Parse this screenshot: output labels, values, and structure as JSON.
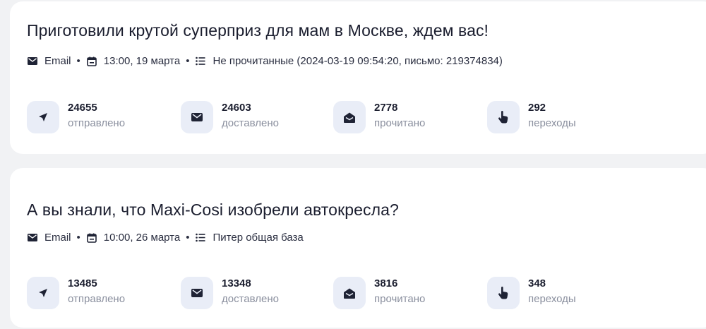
{
  "campaigns": [
    {
      "title": "Приготовили крутой суперприз для мам в Москве, ждем вас!",
      "channel": "Email",
      "datetime": "13:00, 19 марта",
      "segment": "Не прочитанные (2024-03-19 09:54:20, письмо: 219374834)",
      "stats": [
        {
          "value": "24655",
          "label": "отправлено",
          "icon": "send-icon"
        },
        {
          "value": "24603",
          "label": "доставлено",
          "icon": "envelope-icon"
        },
        {
          "value": "2778",
          "label": "прочитано",
          "icon": "envelope-open-icon"
        },
        {
          "value": "292",
          "label": "переходы",
          "icon": "pointer-hand-icon"
        }
      ]
    },
    {
      "title": "А вы знали, что Maxi-Cosi изобрели автокресла?",
      "channel": "Email",
      "datetime": "10:00, 26 марта",
      "segment": "Питер общая база",
      "stats": [
        {
          "value": "13485",
          "label": "отправлено",
          "icon": "send-icon"
        },
        {
          "value": "13348",
          "label": "доставлено",
          "icon": "envelope-icon"
        },
        {
          "value": "3816",
          "label": "прочитано",
          "icon": "envelope-open-icon"
        },
        {
          "value": "348",
          "label": "переходы",
          "icon": "pointer-hand-icon"
        }
      ]
    }
  ],
  "separator": "•",
  "colors": {
    "page_bg": "#f1f2f4",
    "card_bg": "#ffffff",
    "badge_bg": "#e9edf7",
    "text_primary": "#1a1d2e",
    "text_muted": "#8a8f9e"
  }
}
